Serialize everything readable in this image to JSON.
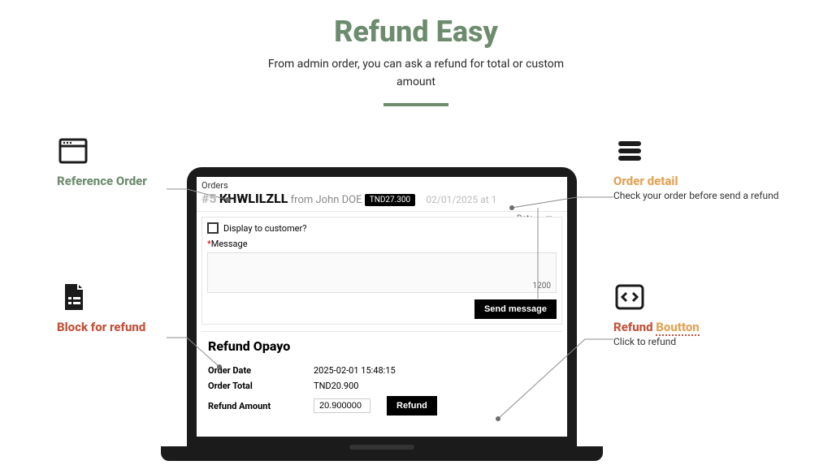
{
  "hero": {
    "title": "Refund Easy",
    "subtitle1": "From admin order, you can ask a refund for total or custom",
    "subtitle2": "amount"
  },
  "screen": {
    "orders_label": "Orders",
    "order_hash": "#5",
    "order_ref": "KHWLILZLL",
    "from_text": "from John DOE",
    "badge": "TND27.300",
    "date_text": "02/01/2025 at 1",
    "display_to_customer": "Display to customer?",
    "msg_req": "*",
    "msg_label": "Message",
    "char_count": "1200",
    "send_btn": "Send message",
    "date_col": "Date",
    "date_col2": "m",
    "refund_title": "Refund Opayo",
    "order_date_k": "Order Date",
    "order_date_v": "2025-02-01 15:48:15",
    "order_total_k": "Order Total",
    "order_total_v": "TND20.900",
    "refund_amt_k": "Refund Amount",
    "refund_amt_v": "20.900000",
    "refund_btn": "Refund"
  },
  "callouts": {
    "ref": {
      "title": "Reference Order"
    },
    "block": {
      "title": "Block for refund"
    },
    "detail": {
      "title": "Order detail",
      "body": "Check your order before send a refund"
    },
    "button": {
      "title_a": "Refund ",
      "title_b": "Boutton",
      "body": "Click to refund"
    }
  }
}
